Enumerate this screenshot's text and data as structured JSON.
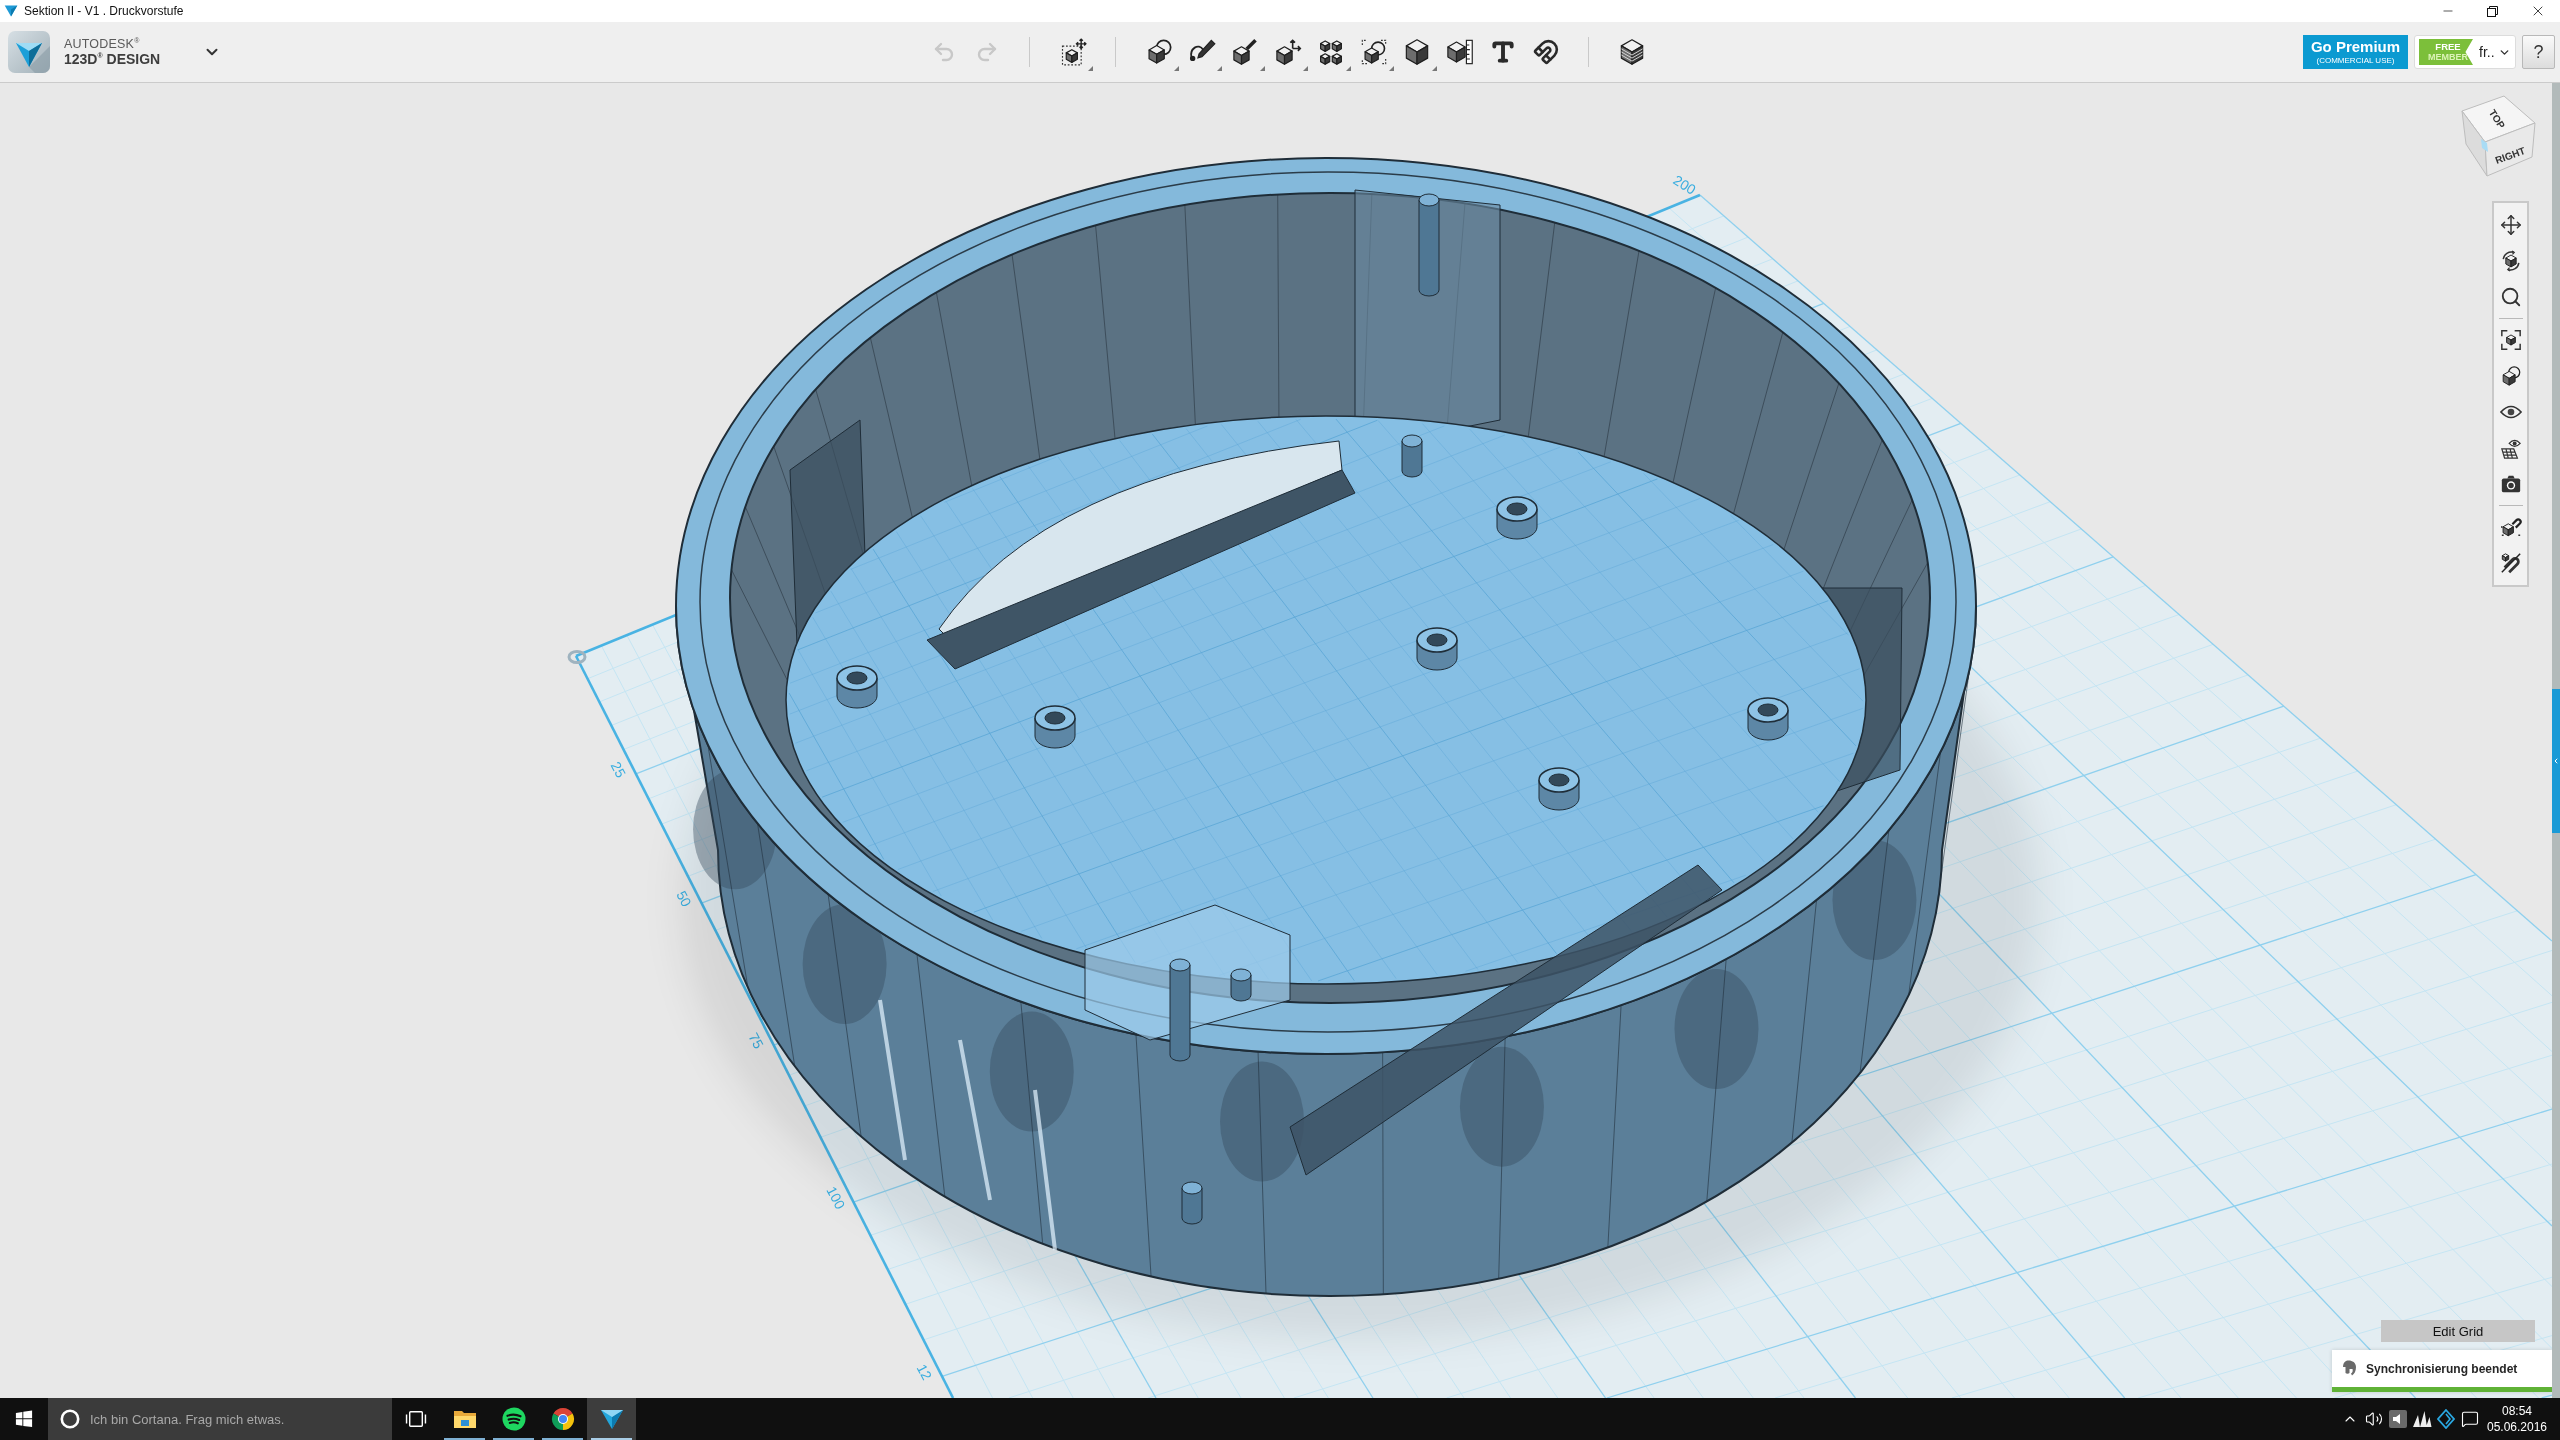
{
  "window": {
    "title": "Sektion II - V1 . Druckvorstufe"
  },
  "header": {
    "brand": {
      "company": "AUTODESK$^{®}$",
      "product": "123D$^{®}$ DESIGN"
    },
    "toolbar": {
      "groups": [
        {
          "items": [
            {
              "kind": "undo",
              "disabled": true,
              "dropdown": false
            },
            {
              "kind": "redo",
              "disabled": true,
              "dropdown": false
            }
          ]
        },
        {
          "items": [
            {
              "kind": "transform",
              "disabled": false,
              "dropdown": true
            }
          ]
        },
        {
          "items": [
            {
              "kind": "primitives",
              "disabled": false,
              "dropdown": true
            },
            {
              "kind": "sketch",
              "disabled": false,
              "dropdown": true
            },
            {
              "kind": "construct",
              "disabled": false,
              "dropdown": true
            },
            {
              "kind": "modify",
              "disabled": false,
              "dropdown": true
            },
            {
              "kind": "pattern",
              "disabled": false,
              "dropdown": true
            },
            {
              "kind": "grouping",
              "disabled": false,
              "dropdown": true
            },
            {
              "kind": "combine",
              "disabled": false,
              "dropdown": true
            },
            {
              "kind": "measure",
              "disabled": false,
              "dropdown": false
            },
            {
              "kind": "text",
              "disabled": false,
              "dropdown": false
            },
            {
              "kind": "snap",
              "disabled": false,
              "dropdown": false
            }
          ]
        },
        {
          "items": [
            {
              "kind": "material",
              "disabled": false,
              "dropdown": false
            }
          ]
        }
      ]
    },
    "premium": {
      "title": "Go Premium",
      "subtitle": "(COMMERCIAL USE)"
    },
    "account": {
      "badge_top": "FREE",
      "badge_bottom": "MEMBER",
      "user": "fr.."
    },
    "help": "?"
  },
  "viewport": {
    "grid": {
      "top_edge_labels": [
        "200"
      ],
      "left_edge_labels": [
        "25",
        "50",
        "75",
        "100",
        "12"
      ]
    },
    "view_cube": {
      "top": "TOP",
      "right": "RIGHT"
    },
    "nav_toolbar": {
      "groups": [
        {
          "items": [
            {
              "kind": "pan"
            },
            {
              "kind": "orbit"
            },
            {
              "kind": "zoom"
            }
          ]
        },
        {
          "items": [
            {
              "kind": "fit"
            },
            {
              "kind": "material_view"
            },
            {
              "kind": "visibility"
            },
            {
              "kind": "grid_visibility"
            },
            {
              "kind": "camera"
            }
          ]
        },
        {
          "items": [
            {
              "kind": "snap_cube"
            },
            {
              "kind": "snap_off"
            }
          ]
        }
      ]
    },
    "edit_grid": "Edit Grid"
  },
  "notification": {
    "text": "Synchronisierung beendet",
    "level": 1
  },
  "taskbar": {
    "search": {
      "placeholder": "Ich bin Cortana. Frag mich etwas."
    },
    "apps": [
      {
        "kind": "explorer",
        "running": true,
        "selected": false
      },
      {
        "kind": "spotify",
        "running": true,
        "selected": false
      },
      {
        "kind": "chrome",
        "running": true,
        "selected": false
      },
      {
        "kind": "design_app",
        "running": true,
        "selected": true
      }
    ],
    "tray": [
      {
        "kind": "overflow"
      },
      {
        "kind": "speaker"
      },
      {
        "kind": "audio_app"
      },
      {
        "kind": "sails"
      },
      {
        "kind": "launcher"
      },
      {
        "kind": "action_center"
      }
    ],
    "clock": {
      "time": "08:54",
      "date": "05.06.2016"
    }
  }
}
